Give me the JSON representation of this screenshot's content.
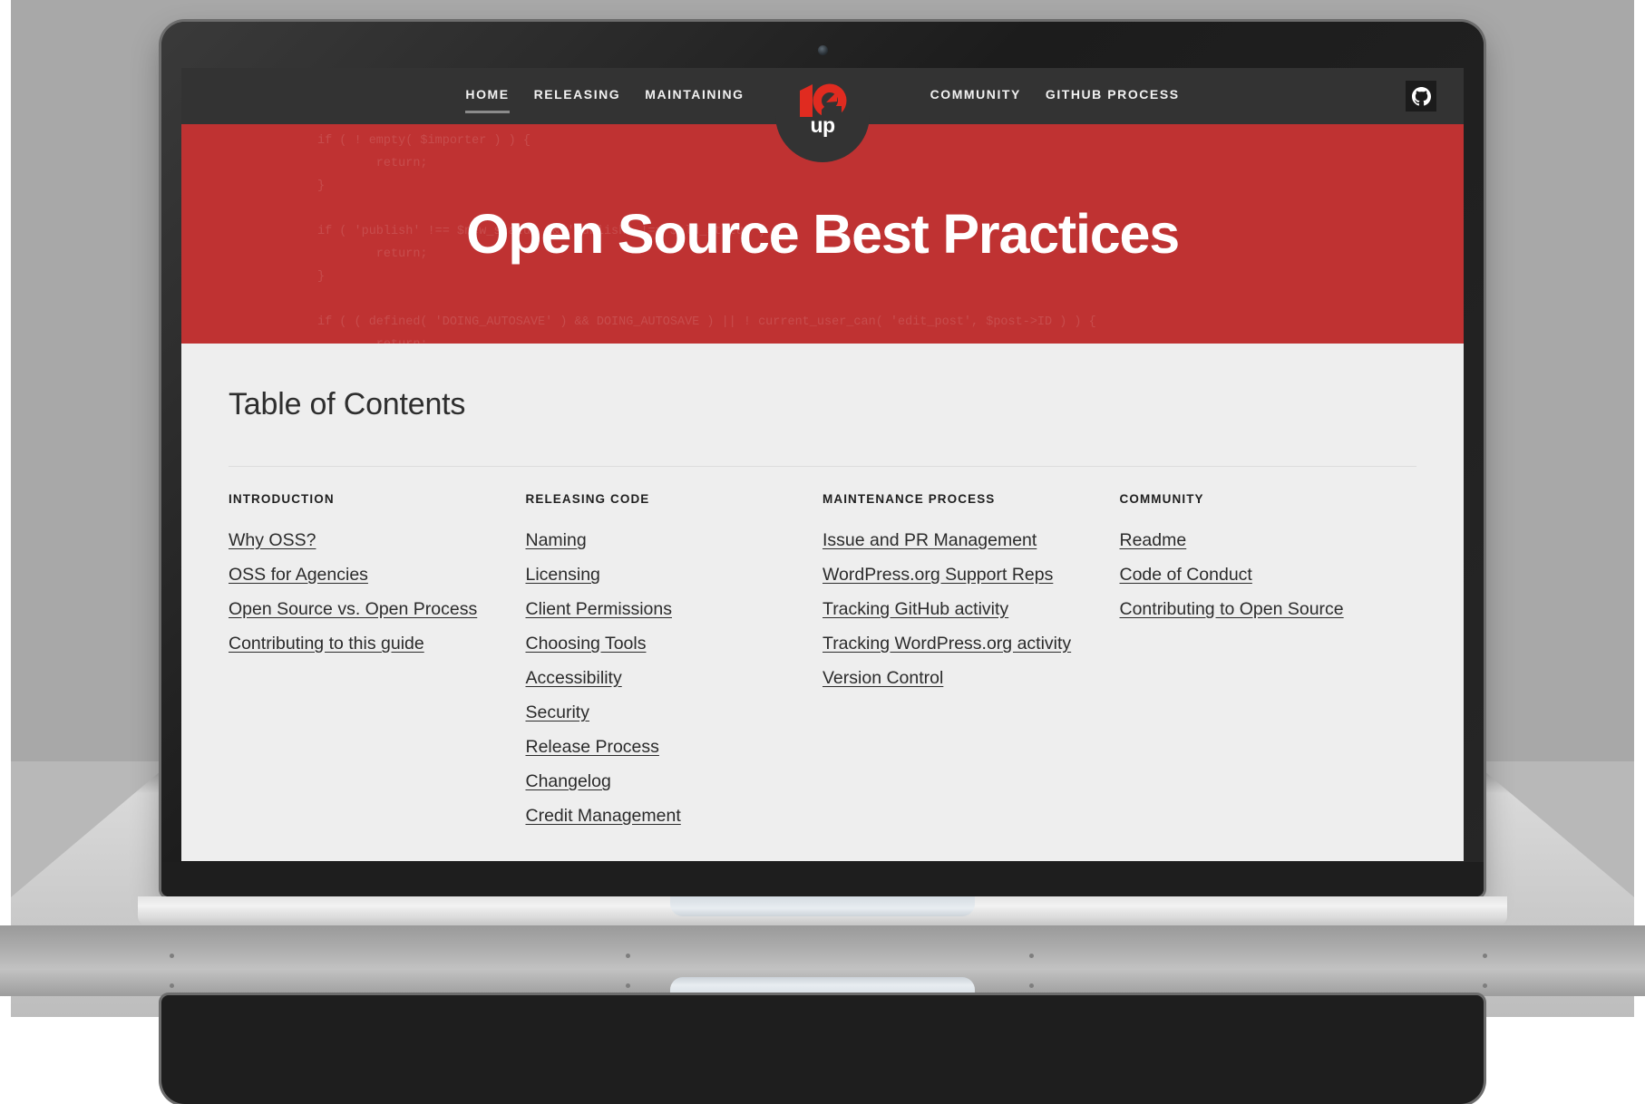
{
  "brand": {
    "logo_text": "10up",
    "logo_sub": "up",
    "logo_color": "#e02b20",
    "accent_red": "#bf3232",
    "topbar_color": "#333333",
    "page_bg": "#eeeeee"
  },
  "nav": {
    "left_items": [
      {
        "label": "HOME",
        "active": true
      },
      {
        "label": "RELEASING",
        "active": false
      },
      {
        "label": "MAINTAINING",
        "active": false
      }
    ],
    "right_items": [
      {
        "label": "COMMUNITY",
        "active": false
      },
      {
        "label": "GITHUB PROCESS",
        "active": false
      }
    ],
    "github_button_icon": "github-icon"
  },
  "hero": {
    "title": "Open Source Best Practices",
    "background_code": "if ( ! empty( $importer ) ) {\n        return;\n}\n\nif ( 'publish' !== $new_status && 'publish' !== $old_status ) {\n        return;\n}\n\nif ( ( defined( 'DOING_AUTOSAVE' ) && DOING_AUTOSAVE ) || ! current_user_can( 'edit_post', $post->ID ) ) {\n        return;\n}\n\n$post_types = get_post_types( array( 'public' => true ) );"
  },
  "main": {
    "page_title": "Table of Contents",
    "columns": [
      {
        "heading": "INTRODUCTION",
        "links": [
          "Why OSS?",
          "OSS for Agencies",
          "Open Source vs. Open Process",
          "Contributing to this guide"
        ]
      },
      {
        "heading": "RELEASING CODE",
        "links": [
          "Naming",
          "Licensing",
          "Client Permissions",
          "Choosing Tools",
          "Accessibility",
          "Security",
          "Release Process",
          "Changelog",
          "Credit Management"
        ]
      },
      {
        "heading": "MAINTENANCE PROCESS",
        "links": [
          "Issue and PR Management",
          "WordPress.org Support Reps",
          "Tracking GitHub activity",
          "Tracking WordPress.org activity",
          "Version Control"
        ]
      },
      {
        "heading": "COMMUNITY",
        "links": [
          "Readme",
          "Code of Conduct",
          "Contributing to Open Source"
        ]
      }
    ]
  }
}
